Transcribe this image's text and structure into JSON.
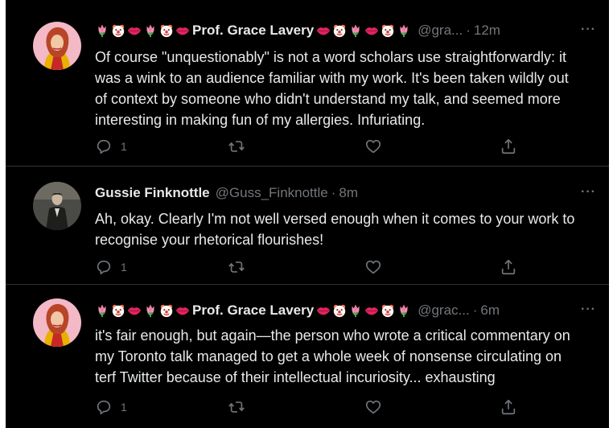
{
  "tweets": [
    {
      "display_name": "Prof. Grace Lavery",
      "handle": "@gra...",
      "time": "12m",
      "more": "···",
      "text": "Of course \"unquestionably\" is not a word scholars use straightforwardly: it\nwas a wink to an audience familiar with my work. It's been taken wildly out\nof context by someone who didn't understand my talk, and seemed more\ninteresting in making fun of my allergies. Infuriating.",
      "reply_count": "1",
      "name_emojis_before": [
        "tulip",
        "clown",
        "lips",
        "tulip",
        "clown",
        "lips"
      ],
      "name_emojis_after": [
        "lips",
        "clown",
        "tulip",
        "lips",
        "clown",
        "tulip"
      ]
    },
    {
      "display_name": "Gussie Finknottle",
      "handle": "@Guss_Finknottle",
      "time": "8m",
      "more": "···",
      "text": "Ah, okay. Clearly I'm not well versed enough when it comes to your work to\nrecognise your rhetorical flourishes!",
      "reply_count": "1"
    },
    {
      "display_name": "Prof. Grace Lavery",
      "handle": "@grac...",
      "time": "6m",
      "more": "···",
      "text": "it's fair enough, but again—the person who wrote a critical commentary on\nmy Toronto talk managed to get a whole week of nonsense circulating on\nterf Twitter because of their intellectual incuriosity... exhausting",
      "reply_count": "1",
      "name_emojis_before": [
        "tulip",
        "clown",
        "lips",
        "tulip",
        "clown",
        "lips"
      ],
      "name_emojis_after": [
        "lips",
        "clown",
        "tulip",
        "lips",
        "clown",
        "tulip"
      ]
    }
  ],
  "icons": {
    "reply": "reply-icon",
    "retweet": "retweet-icon",
    "like": "like-icon",
    "share": "share-icon"
  },
  "colors": {
    "background": "#000000",
    "text": "#e7e9ea",
    "secondary": "#71767b",
    "divider": "#2f3336"
  }
}
